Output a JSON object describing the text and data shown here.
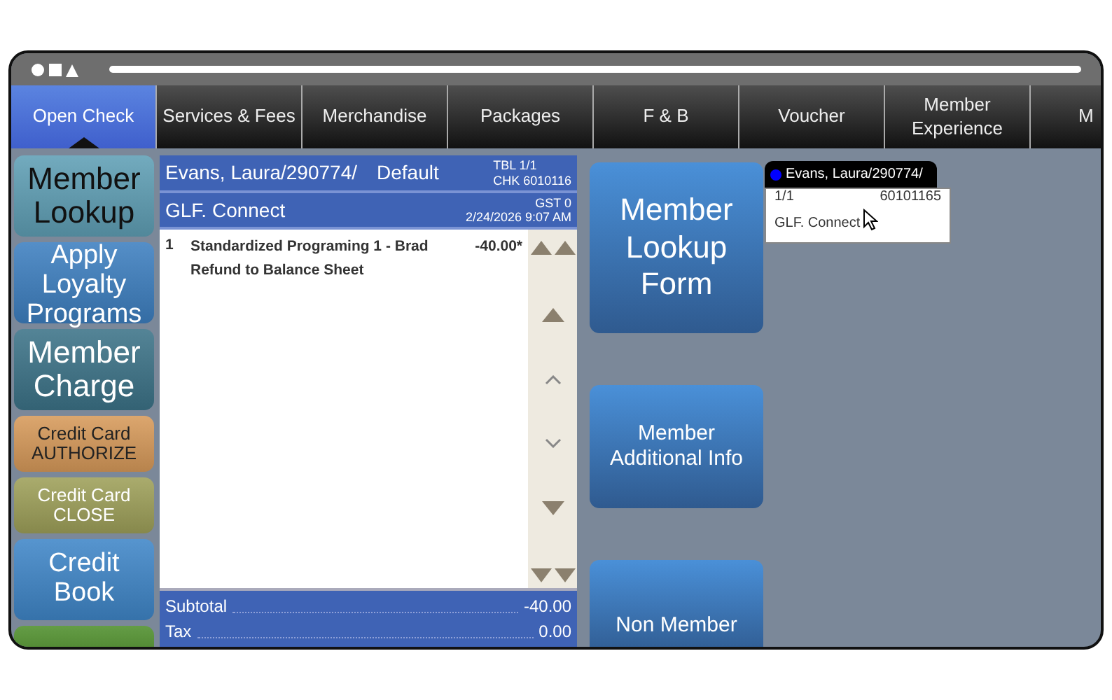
{
  "tabs": [
    {
      "label": "Open Check",
      "selected": true
    },
    {
      "label": "Services & Fees",
      "selected": false
    },
    {
      "label": "Merchandise",
      "selected": false
    },
    {
      "label": "Packages",
      "selected": false
    },
    {
      "label": "F & B",
      "selected": false
    },
    {
      "label": "Voucher",
      "selected": false
    },
    {
      "label": "Member Experience",
      "selected": false
    },
    {
      "label": "M",
      "selected": false
    }
  ],
  "left_buttons": [
    {
      "label": "Member Lookup",
      "kind": "large",
      "color": "#5f9fb5"
    },
    {
      "label": "Apply Loyalty Programs",
      "kind": "medium",
      "color": "#3d7fc0"
    },
    {
      "label": "Member Charge",
      "kind": "large",
      "color": "#3c7388"
    },
    {
      "label": "Credit Card AUTHORIZE",
      "kind": "small",
      "color": "#d79a5a"
    },
    {
      "label": "Credit Card CLOSE",
      "kind": "small",
      "color": "#9ea059"
    },
    {
      "label": "Credit Book",
      "kind": "medium",
      "color": "#3f86c8"
    },
    {
      "kind": "blank",
      "color": "#4f8f2c"
    }
  ],
  "check": {
    "name": "Evans, Laura/290774/",
    "profile": "Default",
    "table": "TBL 1/1",
    "check_no": "CHK 6010116",
    "subtitle": "GLF. Connect",
    "guests": "GST 0",
    "datetime": "2/24/2026 9:07 AM",
    "items": [
      {
        "qty": "1",
        "description": "Standardized Programing 1 - Brad Refund to Balance Sheet",
        "amount": "-40.00*"
      }
    ],
    "totals": [
      {
        "label": "Subtotal",
        "value": "-40.00"
      },
      {
        "label": "Tax",
        "value": "0.00"
      }
    ]
  },
  "right_buttons": [
    {
      "label": "Member Lookup Form",
      "kind": "large"
    },
    {
      "label": "Member Additional Info",
      "kind": "small"
    },
    {
      "label": "Non Member",
      "kind": "small"
    }
  ],
  "popup": {
    "title": "Evans, Laura/290774/",
    "color": "#0000ff",
    "table": "1/1",
    "check_no": "60101165",
    "subtitle": "GLF. Connect"
  }
}
